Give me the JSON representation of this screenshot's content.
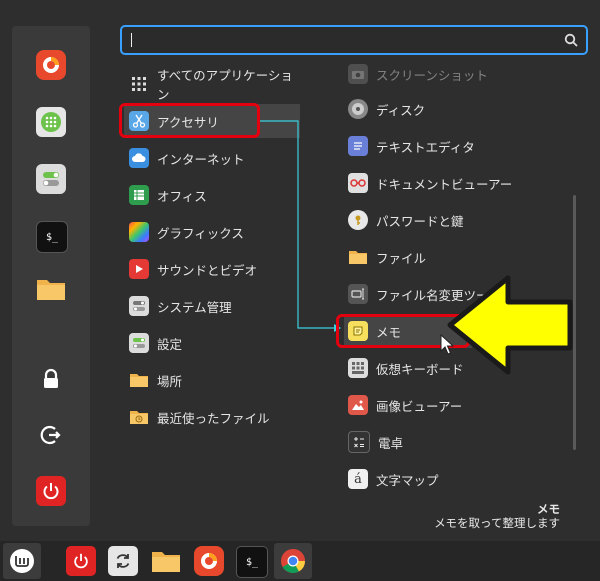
{
  "search": {
    "value": ""
  },
  "favorites": [
    {
      "name": "firefox-icon"
    },
    {
      "name": "software-manager-icon"
    },
    {
      "name": "settings-toggle-icon"
    },
    {
      "name": "terminal-icon"
    },
    {
      "name": "folder-icon"
    },
    {
      "name": "lock-icon"
    },
    {
      "name": "logout-icon"
    },
    {
      "name": "power-icon"
    }
  ],
  "categories": [
    {
      "label": "すべてのアプリケーション"
    },
    {
      "label": "アクセサリ"
    },
    {
      "label": "インターネット"
    },
    {
      "label": "オフィス"
    },
    {
      "label": "グラフィックス"
    },
    {
      "label": "サウンドとビデオ"
    },
    {
      "label": "システム管理"
    },
    {
      "label": "設定"
    },
    {
      "label": "場所"
    },
    {
      "label": "最近使ったファイル"
    }
  ],
  "apps": [
    {
      "label": "スクリーンショット"
    },
    {
      "label": "ディスク"
    },
    {
      "label": "テキストエディタ"
    },
    {
      "label": "ドキュメントビューアー"
    },
    {
      "label": "パスワードと鍵"
    },
    {
      "label": "ファイル"
    },
    {
      "label": "ファイル名変更ツール"
    },
    {
      "label": "メモ"
    },
    {
      "label": "仮想キーボード"
    },
    {
      "label": "画像ビューアー"
    },
    {
      "label": "電卓"
    },
    {
      "label": "文字マップ"
    }
  ],
  "tooltip": {
    "title": "メモ",
    "description": "メモを取って整理します"
  },
  "colors": {
    "highlight_red": "#e3000f",
    "arrow_yellow": "#ffff00",
    "connector_cyan": "#3ad0e0",
    "search_border": "#3aa0ff"
  }
}
